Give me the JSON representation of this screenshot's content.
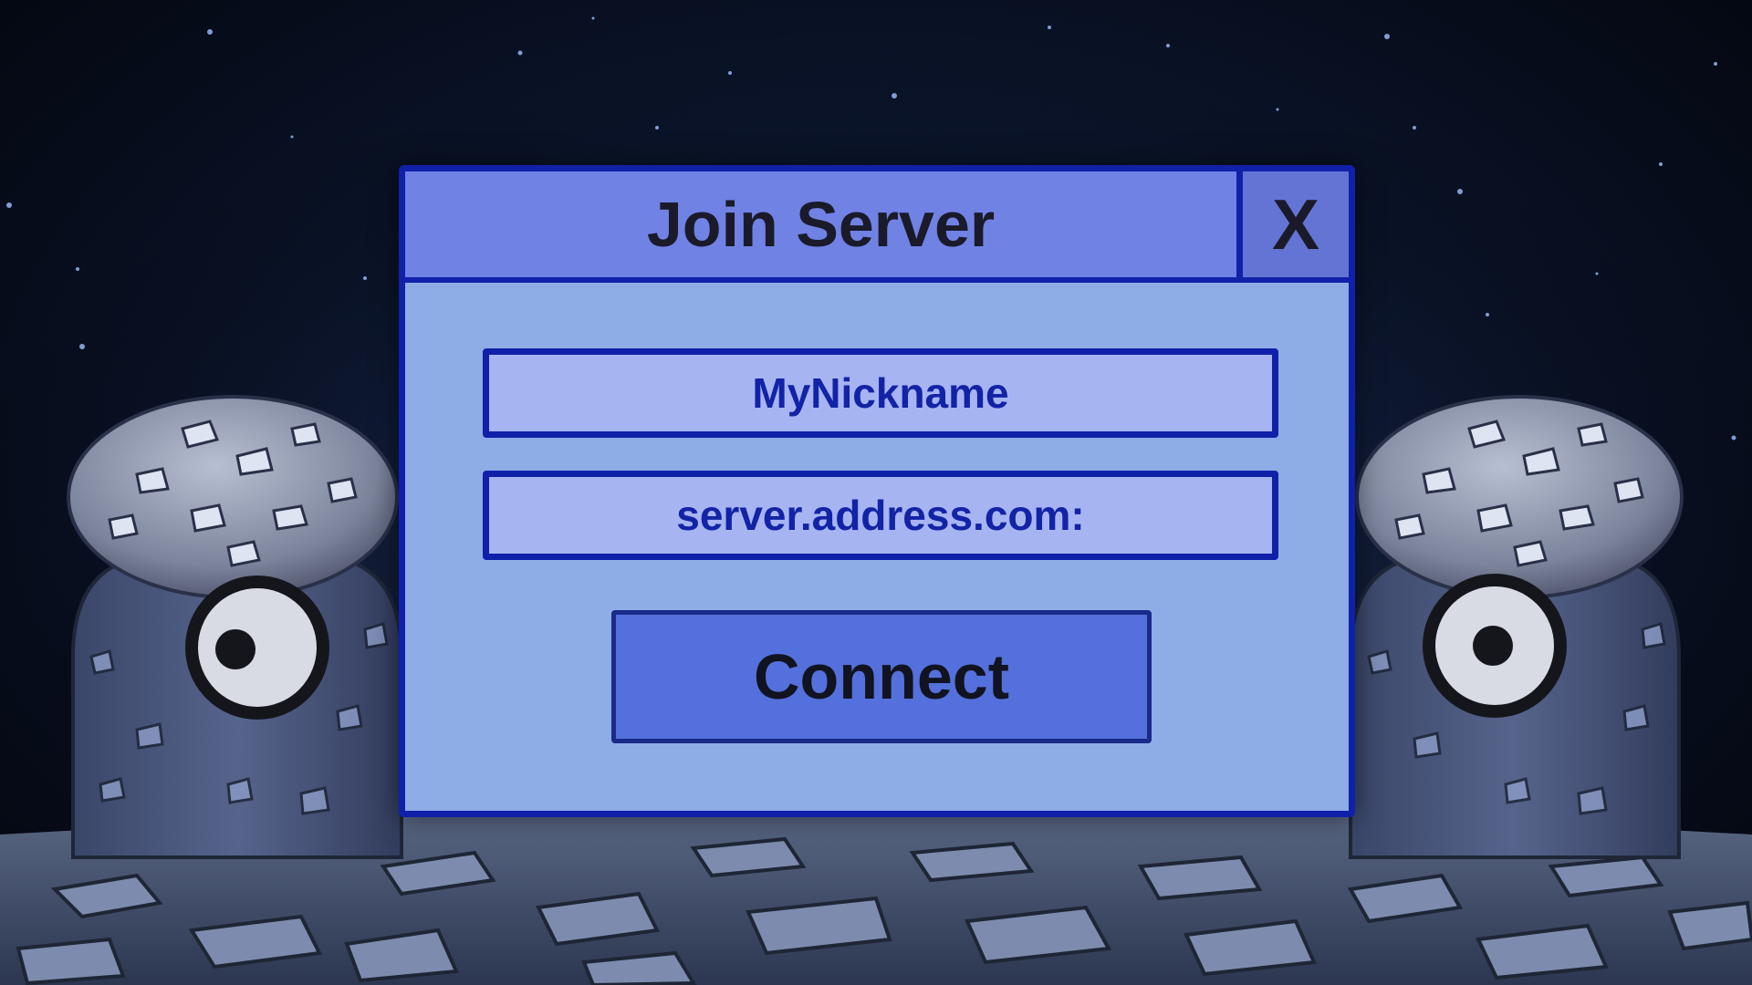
{
  "dialog": {
    "title": "Join Server",
    "close_label": "X",
    "nickname_value": "MyNickname",
    "address_value": "server.address.com:",
    "connect_label": "Connect"
  },
  "colors": {
    "dialog_border": "#1020a8",
    "dialog_body": "#8eace6",
    "titlebar": "#7082e4",
    "input_fill": "#a6b4f2",
    "input_text": "#1223a6",
    "button_fill": "#5470dc",
    "sky": "#0c1730",
    "ground": "#4a5a7a"
  },
  "scene": {
    "decorations": [
      "stone-cyclops-left",
      "stone-cyclops-right",
      "cobblestone-ground",
      "starfield"
    ]
  }
}
